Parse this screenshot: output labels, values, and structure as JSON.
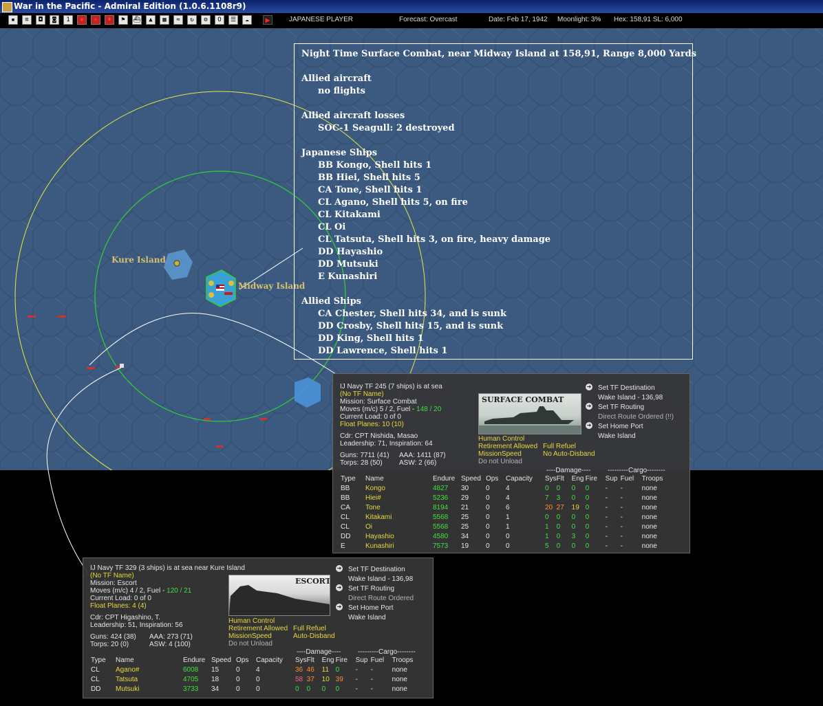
{
  "window": {
    "title": "War in the Pacific - Admiral Edition (1.0.6.1108r9)"
  },
  "toolbar": {
    "buttons": [
      "a",
      "b",
      "c",
      "d",
      "e",
      "f",
      "g",
      "h",
      "i",
      "j",
      "k",
      "l",
      "m",
      "n",
      "o",
      "p",
      "q",
      "r",
      "s"
    ],
    "player": "JAPANESE PLAYER",
    "forecast": "Forecast: Overcast",
    "date": "Date: Feb 17, 1942",
    "moonlight": "Moonlight: 3%",
    "hex": "Hex: 158,91  SL: 6,000"
  },
  "map": {
    "labels": {
      "kure": "Kure Island",
      "midway": "Midway Island"
    }
  },
  "report": {
    "title": "Night Time Surface Combat, near Midway Island at 158,91, Range 8,000 Yards",
    "allied_aircraft_header": "Allied aircraft",
    "allied_aircraft": [
      "no flights"
    ],
    "allied_losses_header": "Allied aircraft losses",
    "allied_losses": [
      "SOC-1 Seagull: 2 destroyed"
    ],
    "japanese_header": "Japanese Ships",
    "japanese": [
      "BB Kongo, Shell hits 1",
      "BB Hiei, Shell hits 5",
      "CA Tone, Shell hits 1",
      "CL Agano, Shell hits 5,  on fire",
      "CL Kitakami",
      "CL Oi",
      "CL Tatsuta, Shell hits 3,  on fire,  heavy damage",
      "DD Hayashio",
      "DD Mutsuki",
      "E Kunashiri"
    ],
    "allied_ships_header": "Allied Ships",
    "allied_ships": [
      "CA Chester, Shell hits 34, and is sunk",
      "DD Crosby, Shell hits 15, and is sunk",
      "DD King, Shell hits 1",
      "DD Lawrence, Shell hits 1"
    ]
  },
  "tf1": {
    "header": "IJ Navy TF 245 (7 ships) is at sea",
    "name": "(No TF Name)",
    "mission": "Mission: Surface Combat",
    "moves": "Moves (m/c) 5 / 2, Fuel - ",
    "fuel": "148 / 20",
    "load": "Current Load: 0 of 0",
    "float": "Float Planes: 10 (10)",
    "cdr": "Cdr: CPT  Nishida, Masao",
    "leadership": "Leadership: 71, Inspiration: 64",
    "guns": "Guns: 7711 (41)",
    "aaa": "AAA: 1411 (87)",
    "torps": "Torps: 28 (50)",
    "asw": "ASW: 2 (66)",
    "image_caption": "SURFACE COMBAT",
    "control": "Human Control",
    "retire": "Retirement Allowed",
    "refuel": "Full Refuel",
    "speed": "MissionSpeed",
    "disband": "No Auto-Disband",
    "unload": "Do not Unload",
    "cmd": {
      "dest": "Set TF Destination",
      "dest_val": "Wake Island - 136,98",
      "routing": "Set TF Routing",
      "routing_val": "Direct Route Ordered (!!)",
      "home": "Set Home Port",
      "home_val": "Wake Island"
    },
    "group_damage": "----Damage----",
    "group_cargo": "---------Cargo--------",
    "cols": [
      "Type",
      "Name",
      "Endure",
      "Speed",
      "Ops",
      "Capacity",
      "Sys",
      "Flt",
      "Eng",
      "Fire",
      "Sup",
      "Fuel",
      "Troops"
    ],
    "rows": [
      [
        "BB",
        "Kongo",
        "4827",
        "30",
        "0",
        "4",
        "0",
        "0",
        "0",
        "0",
        "-",
        "-",
        "none"
      ],
      [
        "BB",
        "Hiei#",
        "5236",
        "29",
        "0",
        "4",
        "7",
        "3",
        "0",
        "0",
        "-",
        "-",
        "none"
      ],
      [
        "CA",
        "Tone",
        "8194",
        "21",
        "0",
        "6",
        "20",
        "27",
        "19",
        "0",
        "-",
        "-",
        "none"
      ],
      [
        "CL",
        "Kitakami",
        "5568",
        "25",
        "0",
        "1",
        "0",
        "0",
        "0",
        "0",
        "-",
        "-",
        "none"
      ],
      [
        "CL",
        "Oi",
        "5568",
        "25",
        "0",
        "1",
        "1",
        "0",
        "0",
        "0",
        "-",
        "-",
        "none"
      ],
      [
        "DD",
        "Hayashio",
        "4580",
        "34",
        "0",
        "0",
        "1",
        "0",
        "3",
        "0",
        "-",
        "-",
        "none"
      ],
      [
        "E",
        "Kunashiri",
        "7573",
        "19",
        "0",
        "0",
        "5",
        "0",
        "0",
        "0",
        "-",
        "-",
        "none"
      ]
    ]
  },
  "tf2": {
    "header": "IJ Navy TF 329 (3 ships) is at sea near Kure Island",
    "name": "(No TF Name)",
    "mission": "Mission: Escort",
    "moves": "Moves (m/c) 4 / 2, Fuel - ",
    "fuel": "120 / 21",
    "load": "Current Load: 0 of 0",
    "float": "Float Planes: 4 (4)",
    "cdr": "Cdr: CPT  Higashino, T.",
    "leadership": "Leadership: 51, Inspiration: 56",
    "guns": "Guns: 424 (38)",
    "aaa": "AAA: 273 (71)",
    "torps": "Torps: 20 (0)",
    "asw": "ASW: 4 (100)",
    "image_caption": "ESCORT",
    "control": "Human Control",
    "retire": "Retirement Allowed",
    "refuel": "Full Refuel",
    "speed": "MissionSpeed",
    "disband": "Auto-Disband",
    "unload": "Do not Unload",
    "cmd": {
      "dest": "Set TF Destination",
      "dest_val": "Wake Island - 136,98",
      "routing": "Set TF Routing",
      "routing_val": "Direct Route Ordered",
      "home": "Set Home Port",
      "home_val": "Wake Island"
    },
    "group_damage": "----Damage----",
    "group_cargo": "---------Cargo--------",
    "cols": [
      "Type",
      "Name",
      "Endure",
      "Speed",
      "Ops",
      "Capacity",
      "Sys",
      "Flt",
      "Eng",
      "Fire",
      "Sup",
      "Fuel",
      "Troops"
    ],
    "rows": [
      [
        "CL",
        "Agano#",
        "6008",
        "15",
        "0",
        "4",
        "36",
        "46",
        "11",
        "0",
        "-",
        "-",
        "none"
      ],
      [
        "CL",
        "Tatsuta",
        "4705",
        "18",
        "0",
        "0",
        "58",
        "37",
        "10",
        "39",
        "-",
        "-",
        "none"
      ],
      [
        "DD",
        "Mutsuki",
        "3733",
        "34",
        "0",
        "0",
        "0",
        "0",
        "0",
        "0",
        "-",
        "-",
        "none"
      ]
    ]
  }
}
